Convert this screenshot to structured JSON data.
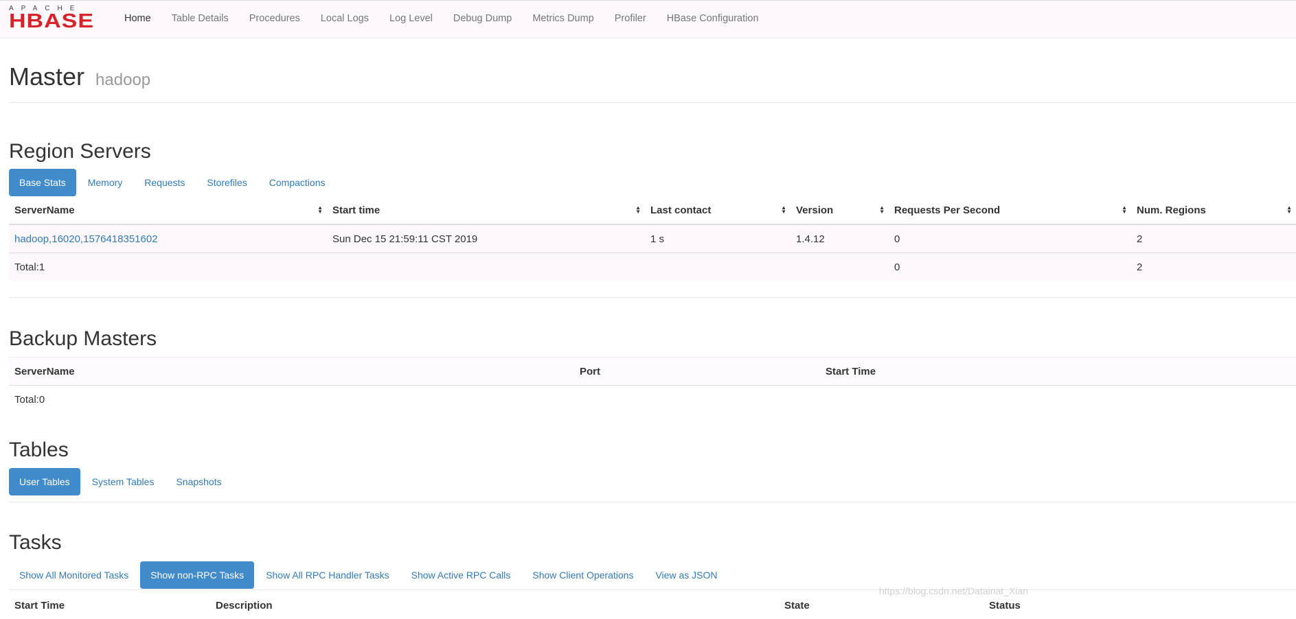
{
  "logo": {
    "apache": "APACHE",
    "hbase": "HBASE"
  },
  "nav": [
    "Home",
    "Table Details",
    "Procedures",
    "Local Logs",
    "Log Level",
    "Debug Dump",
    "Metrics Dump",
    "Profiler",
    "HBase Configuration"
  ],
  "page": {
    "title": "Master",
    "host": "hadoop"
  },
  "region_servers": {
    "title": "Region Servers",
    "tabs": [
      "Base Stats",
      "Memory",
      "Requests",
      "Storefiles",
      "Compactions"
    ],
    "columns": [
      "ServerName",
      "Start time",
      "Last contact",
      "Version",
      "Requests Per Second",
      "Num. Regions"
    ],
    "row": {
      "server": "hadoop,16020,1576418351602",
      "start": "Sun Dec 15 21:59:11 CST 2019",
      "contact": "1 s",
      "version": "1.4.12",
      "rps": "0",
      "regions": "2"
    },
    "total": {
      "label": "Total:1",
      "rps": "0",
      "regions": "2"
    }
  },
  "backup_masters": {
    "title": "Backup Masters",
    "columns": [
      "ServerName",
      "Port",
      "Start Time"
    ],
    "total": "Total:0"
  },
  "tables": {
    "title": "Tables",
    "tabs": [
      "User Tables",
      "System Tables",
      "Snapshots"
    ]
  },
  "tasks": {
    "title": "Tasks",
    "tabs": [
      "Show All Monitored Tasks",
      "Show non-RPC Tasks",
      "Show All RPC Handler Tasks",
      "Show Active RPC Calls",
      "Show Client Operations",
      "View as JSON"
    ],
    "columns": [
      "Start Time",
      "Description",
      "State",
      "Status"
    ]
  },
  "watermark": "https://blog.csdn.net/Datainat_Xian",
  "colors": {
    "brand": "#d8232a",
    "accent": "#428bca",
    "link": "#337ab7"
  }
}
